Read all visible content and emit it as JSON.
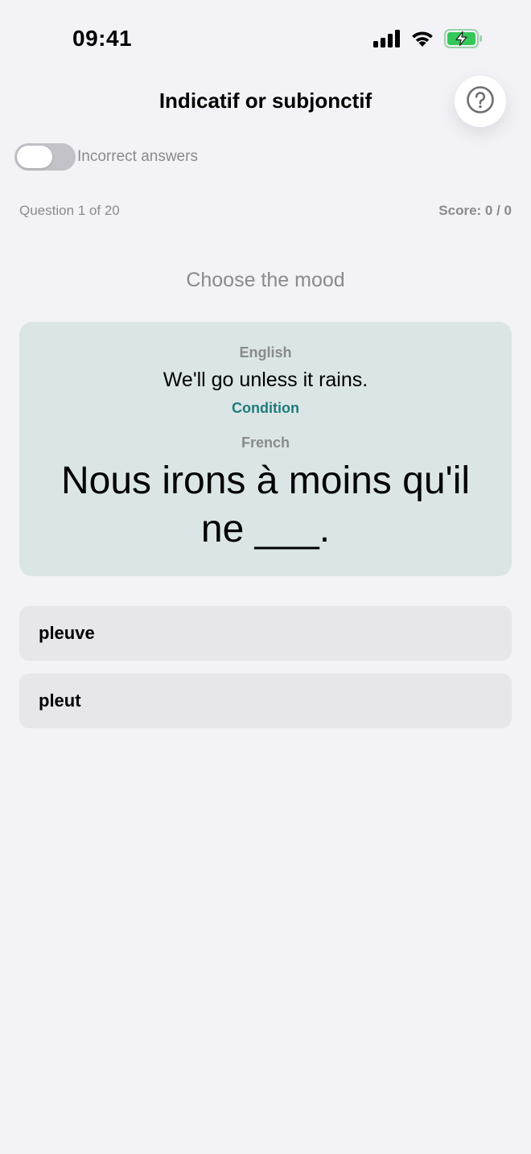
{
  "status_bar": {
    "time": "09:41",
    "icons": [
      "cellular-signal-icon",
      "wifi-icon",
      "battery-charging-icon"
    ]
  },
  "header": {
    "title": "Indicatif or subjonctif",
    "help_icon": "question-circle-icon"
  },
  "filter": {
    "toggle_label": "Incorrect answers",
    "toggle_on": false
  },
  "progress": {
    "question_counter": "Question 1 of 20",
    "score": "Score: 0 / 0"
  },
  "instruction": "Choose the mood",
  "card": {
    "english_label": "English",
    "english_text": "We'll go unless it rains.",
    "hint": "Condition",
    "french_label": "French",
    "french_text": "Nous irons à moins qu'il ne ___."
  },
  "answers": [
    {
      "label": "pleuve"
    },
    {
      "label": "pleut"
    }
  ],
  "colors": {
    "background": "#f2f2f7",
    "card": "#dbe5e6",
    "accent": "#1f7a7a",
    "answer_bg": "#e6e6eb",
    "battery": "#34c759"
  }
}
